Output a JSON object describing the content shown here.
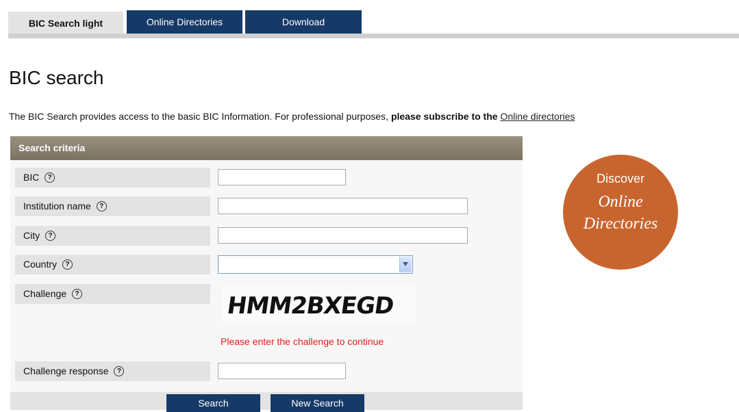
{
  "tabs": {
    "bic_search_light": "BIC Search light",
    "online_directories": "Online Directories",
    "download": "Download"
  },
  "page": {
    "title": "BIC search",
    "intro_text": "The BIC Search provides access to the basic BIC Information. For professional purposes, ",
    "intro_bold": "please subscribe to the ",
    "intro_link": "Online directories"
  },
  "form": {
    "section_title": "Search criteria",
    "help_glyph": "?",
    "fields": {
      "bic": {
        "label": "BIC",
        "value": ""
      },
      "institution_name": {
        "label": "Institution name",
        "value": ""
      },
      "city": {
        "label": "City",
        "value": ""
      },
      "country": {
        "label": "Country",
        "value": ""
      },
      "challenge": {
        "label": "Challenge",
        "captcha_text": "HMM2BXEGD"
      },
      "challenge_response": {
        "label": "Challenge response",
        "value": ""
      }
    },
    "error_message": "Please enter the challenge to continue",
    "search_button": "Search",
    "new_search_button": "New Search"
  },
  "promo": {
    "line1": "Discover",
    "line2": "Online",
    "line3": "Directories"
  },
  "colors": {
    "nav_blue": "#163a67",
    "header_brown": "#8b8272",
    "promo_orange": "#c8652f",
    "error_red": "#e02020"
  }
}
